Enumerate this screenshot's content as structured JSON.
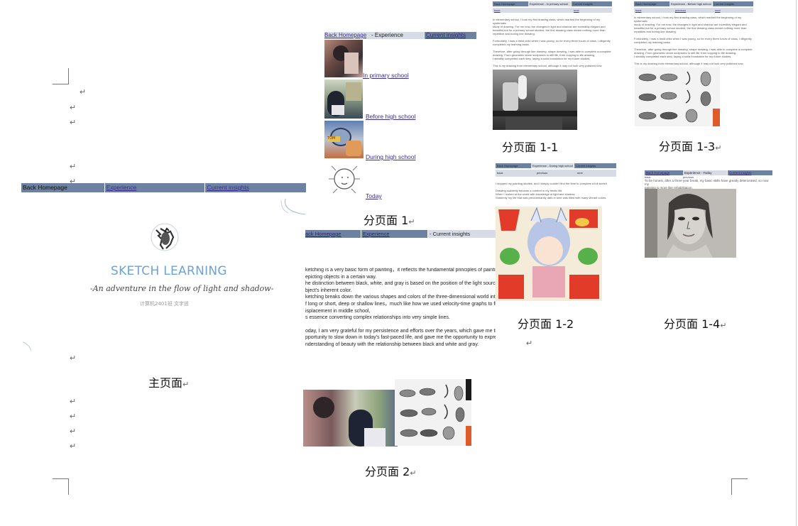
{
  "paragraph_mark": "↵",
  "main_page": {
    "nav": [
      "Back Homepage",
      " Experience",
      " Current insights"
    ],
    "title": "SKETCH LEARNING",
    "subtitle": "-An adventure in the flow of light and shadow-",
    "author": "计算机2401班 文字遥",
    "caption": "主页面"
  },
  "subpage1": {
    "nav": [
      "Back Homepage",
      " - Experience",
      " Current insights"
    ],
    "links": [
      " In primary school",
      "Before high school",
      "During high school",
      "Today"
    ],
    "caption": "分页面  1"
  },
  "subpage2": {
    "nav": [
      "ack Homepage",
      " Experience",
      " - Current insights"
    ],
    "paragraphs": [
      "ketching is a very basic form of painting，it reflects the fundamental principles of painting by",
      "epicting objects in a certain way.",
      "he distinction between black, white, and gray is based on the position of the light source and the",
      "bject's inherent color.",
      "ketching breaks down the various shapes and colors of the three-dimensional world into a series",
      "f long or short, deep or shallow lines，much like how we used velocity-time graphs to find",
      "isplacement in middle school,",
      "s essence converting complex relationships into very simple lines.",
      "",
      "oday, I am very grateful for my persistence and efforts over the years, which gave me the",
      "pportunity to slow down in today's fast-paced life, and gave me the opportunity to express my",
      "nderstanding of beauty with the relationship between black and white and gray."
    ],
    "caption": "分页面  2"
  },
  "subpage1_1": {
    "nav": [
      "Back Homepage",
      "Experience - In primary school",
      "Current insights"
    ],
    "subnav": [
      "back",
      "",
      "next"
    ],
    "text": [
      "In elementary school, I took my first drawing class, which marked the beginning of my systematic",
      "study of drawing. For me now, the changes in light and shadow are incredibly elegant and",
      "beautiful,but for a primary school student, the first drawing class meant nothing more than",
      "repetitive and boring line drawing.",
      "",
      "Fortunately, I was a timid child when I was young, so for every three hours of class, I diligently",
      "completed my learning tasks.",
      "",
      "Therefore, after going through line drawing, shape drawing, I was able to complete a complete",
      "drawing. From geometric stone sculptures to still life, from copying to life drawing,",
      "I steadily completed each step, laying a solid foundation for my future studies.",
      "",
      "This is my drawing from elementary school, although it may not look very polished now."
    ],
    "caption": "分页面 1-1"
  },
  "subpage1_2": {
    "nav": [
      "Back Homepage",
      "Experience - During high school",
      "Current insights"
    ],
    "subnav": [
      "back",
      "previous",
      "next"
    ],
    "text": [
      "I stopped my painting studies, and I simply couldn't find the time to complete a full sketch",
      "",
      "Drawing suddenly became a comfort in my hectic life.",
      "When I looked at the world with knowledge of light and shadow,",
      "Suddenly my life that was predominantly dark in tone was filled with many vibrant colors."
    ],
    "caption": "分页面  1-2"
  },
  "subpage1_3": {
    "nav": [
      "Back Homepage",
      "Experience - Before high school",
      "Current insights"
    ],
    "subnav": [
      "back",
      "previous",
      "next"
    ],
    "text": [
      "In elementary school, I took my first drawing class, which marked the beginning of my systematic",
      "study of drawing. For me now, the changes in light and shadow are incredibly elegant and",
      "beautiful,but for a primary school student, the first drawing class meant nothing more than",
      "repetitive and boring line drawing.",
      "",
      "Fortunately, I was a timid child when I was young, so for every three hours of class, I diligently",
      "completed my learning tasks.",
      "",
      "Therefore, after going through line drawing, shape drawing, I was able to complete a complete",
      "drawing. From geometric stone sculptures to still life, from copying to life drawing,",
      "I steadily completed each step, laying a solid foundation for my future studies.",
      "",
      "This is my drawing from elementary school, although it may not look very polished now."
    ],
    "caption": "分页面 1-3"
  },
  "subpage1_4": {
    "nav": [
      "Back Homepage",
      " Experience - Today",
      " Current insights"
    ],
    "subnav": [
      "back",
      "previous"
    ],
    "text": [
      "To be honest, after a three-year break, my basic skills have greatly deteriorated, so now my",
      "painting is more like rehabilitation."
    ],
    "caption": "分页面 1-4"
  }
}
